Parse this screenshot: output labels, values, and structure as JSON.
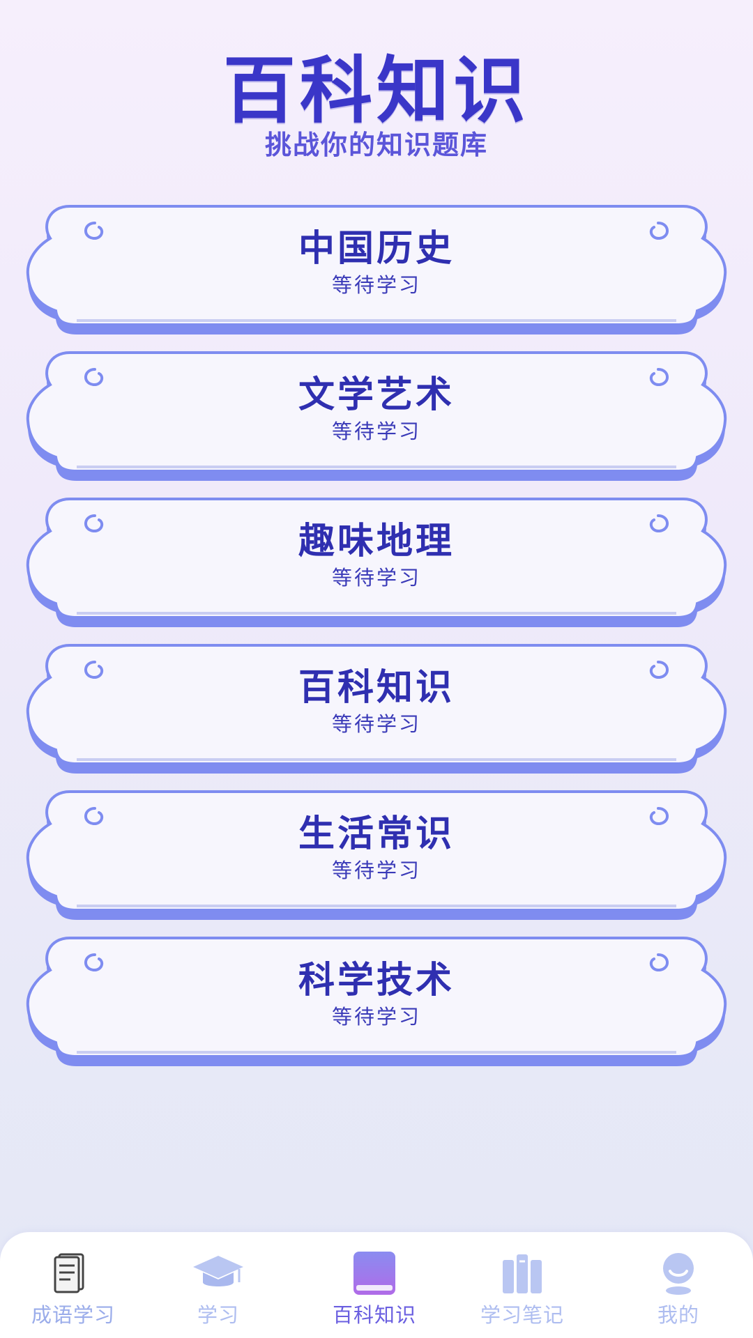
{
  "header": {
    "title": "百科知识",
    "subtitle": "挑战你的知识题库"
  },
  "categories": [
    {
      "title": "中国历史",
      "status": "等待学习"
    },
    {
      "title": "文学艺术",
      "status": "等待学习"
    },
    {
      "title": "趣味地理",
      "status": "等待学习"
    },
    {
      "title": "百科知识",
      "status": "等待学习"
    },
    {
      "title": "生活常识",
      "status": "等待学习"
    },
    {
      "title": "科学技术",
      "status": "等待学习"
    }
  ],
  "tabbar": {
    "active_index": 2,
    "items": [
      {
        "label": "成语学习",
        "icon": "document-icon"
      },
      {
        "label": "学习",
        "icon": "graduation-cap-icon"
      },
      {
        "label": "百科知识",
        "icon": "book-icon"
      },
      {
        "label": "学习笔记",
        "icon": "books-icon"
      },
      {
        "label": "我的",
        "icon": "user-icon"
      }
    ]
  },
  "colors": {
    "primary": "#3a36c8",
    "accent": "#6a5fe0",
    "card_border": "#7e8cf0",
    "inactive_tab": "#aebdf0"
  }
}
